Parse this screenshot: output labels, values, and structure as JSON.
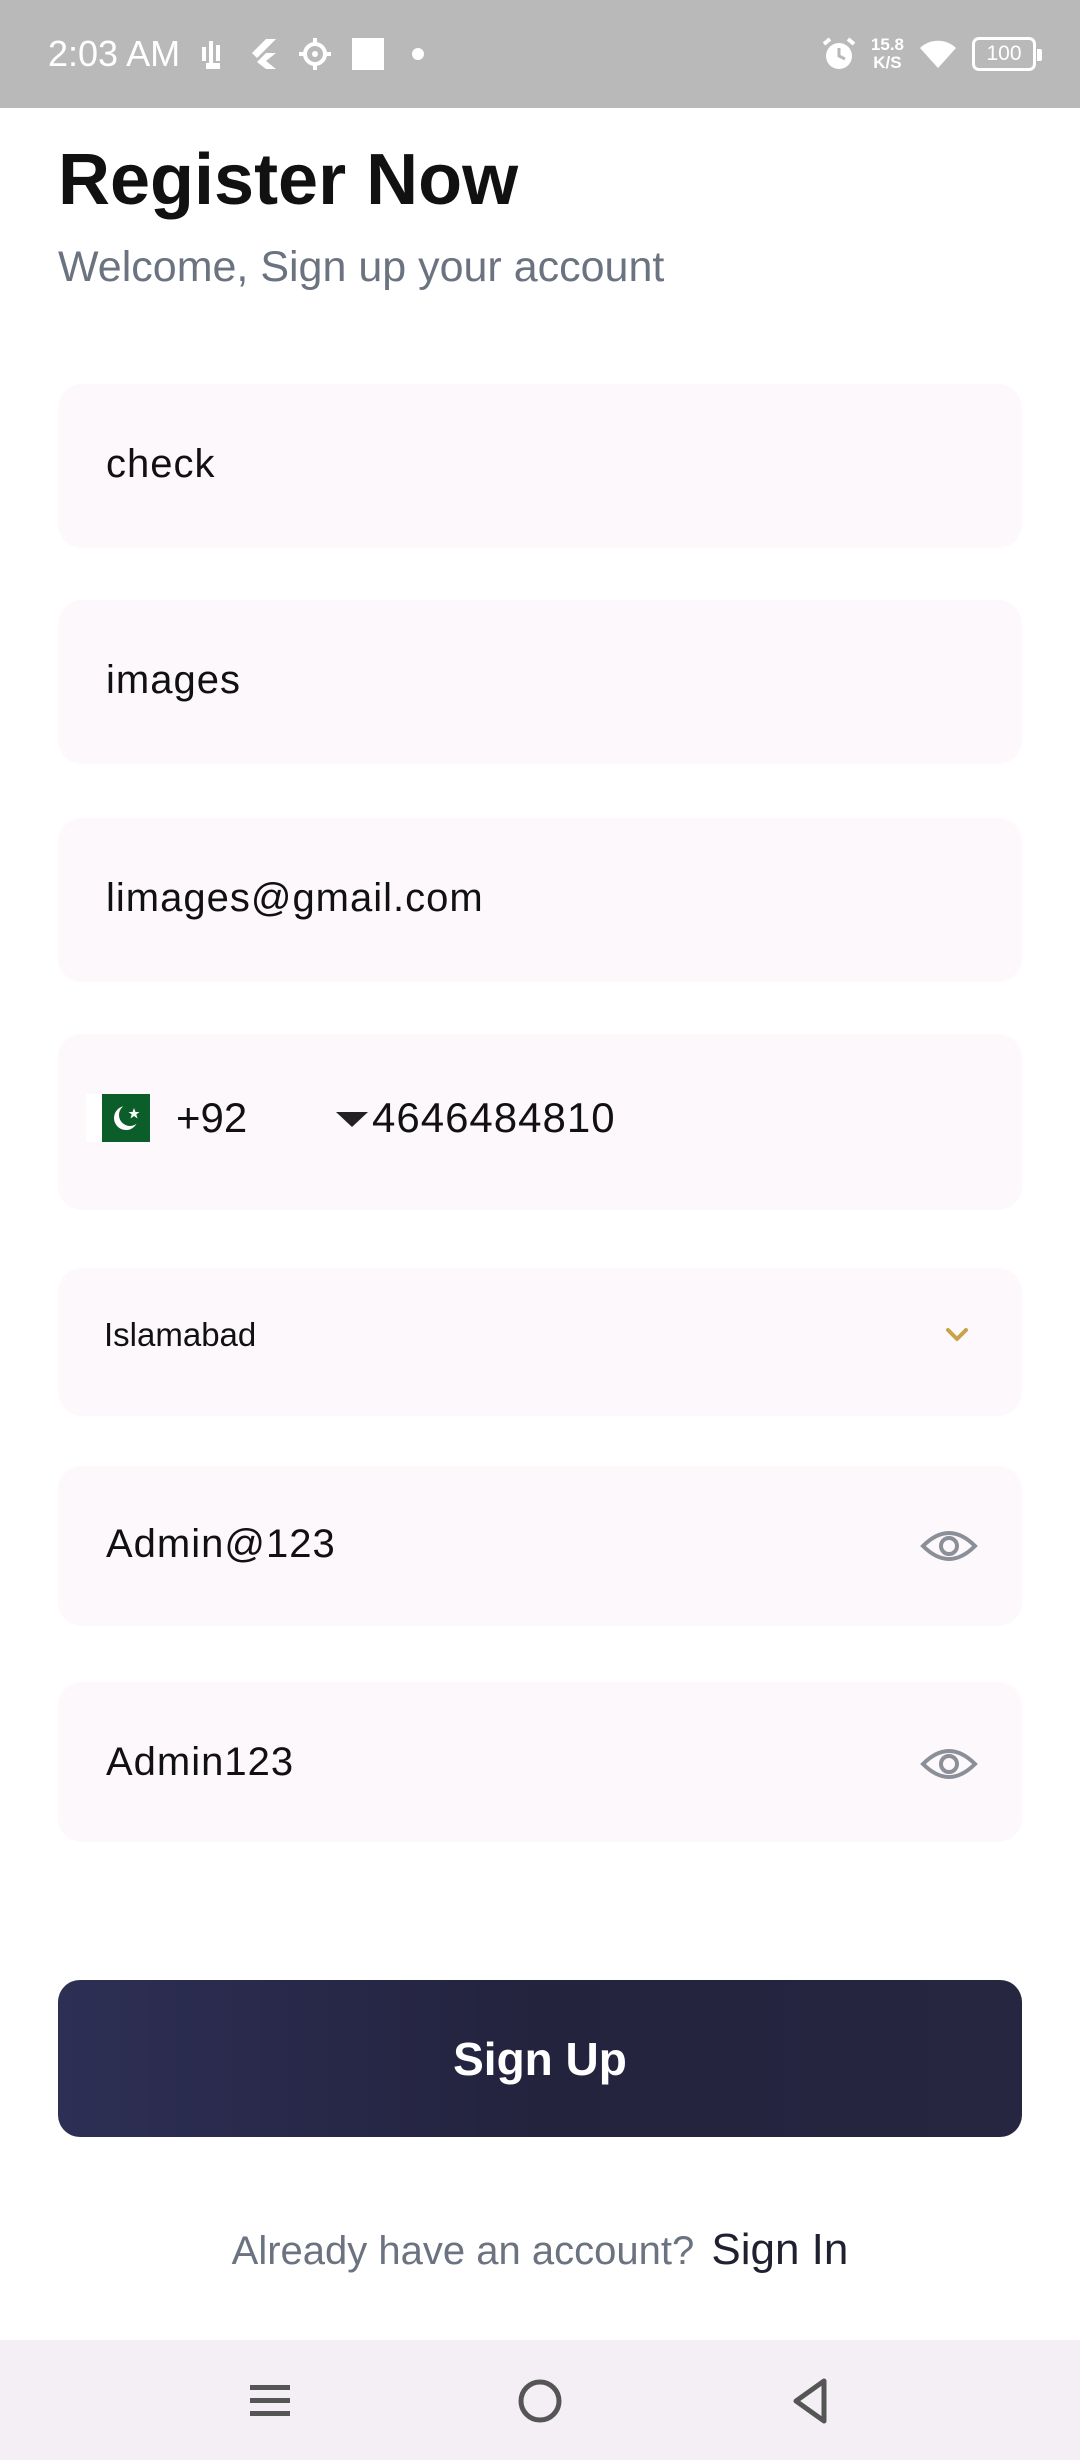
{
  "status_bar": {
    "time": "2:03 AM",
    "net_speed_value": "15.8",
    "net_speed_unit": "K/S",
    "battery": "100",
    "icons": [
      "sim-signal-icon",
      "flutter-icon",
      "settings-gear-icon",
      "white-square-icon",
      "dot-icon",
      "alarm-icon",
      "wifi-icon",
      "battery-icon"
    ]
  },
  "header": {
    "title": "Register Now",
    "subtitle": "Welcome, Sign up your account"
  },
  "form": {
    "first_name": "check",
    "last_name": "images",
    "email": "limages@gmail.com",
    "phone": {
      "country_code": "+92",
      "number": "4646484810",
      "flag_icon": "pakistan-flag-icon"
    },
    "city": "Islamabad",
    "password": "Admin@123",
    "confirm_password": "Admin123"
  },
  "actions": {
    "signup_label": "Sign Up",
    "signin_prompt": "Already have an account?",
    "signin_link": "Sign In"
  },
  "colors": {
    "field_bg": "#fdf8fc",
    "button_bg": "#2a2b4a",
    "accent_chevron": "#c9a24a",
    "muted_text": "#6b7280"
  },
  "nav_bar": {
    "icons": [
      "menu-icon",
      "home-circle-icon",
      "back-triangle-icon"
    ]
  }
}
